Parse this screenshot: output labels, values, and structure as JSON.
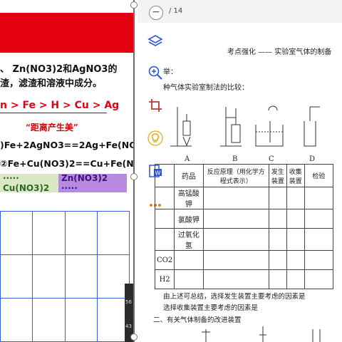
{
  "left_panel": {
    "line1": "、 Zn(NO3)2和AgNO3的",
    "line2": "渣，滤渣和溶液中成分。",
    "order": "n > Fe > H > Cu > Ag",
    "slogan": "“距离产生美”",
    "eq1": ")Fe+2AgNO3==2Ag+Fe(NO3)2",
    "eq2": "②Fe+Cu(NO3)2==Cu+Fe(NO3)2",
    "strip1": "····· Cu(NO3)2",
    "strip2": "Zn(NO3)2 ·····"
  },
  "viewer": {
    "page_count": "/ 14",
    "zoom_out_label": "−"
  },
  "tools": [
    {
      "icon": "layers-icon",
      "color": "#2f55d4"
    },
    {
      "icon": "zoom-in-icon",
      "color": "#2f55d4"
    },
    {
      "icon": "crop-icon",
      "color": "#c0392b"
    },
    {
      "icon": "lightbulb-icon",
      "color": "#e6a817"
    },
    {
      "icon": "word-export-icon",
      "color": "#2f55d4"
    },
    {
      "icon": "more-icon",
      "color": "#e67e22"
    }
  ],
  "document": {
    "header": "考点强化 —— 实验室气体的制备",
    "section_frag": "举：",
    "intro": "种气体实验室制法的比较：",
    "apparatus_labels": [
      "A",
      "B",
      "C",
      "D"
    ],
    "table_head": [
      "药品",
      "反应原理（用化学方程式表示）",
      "发生装置",
      "收集装置",
      "检验"
    ],
    "rows": [
      "高锰酸钾",
      "氯酸钾",
      "过氧化氢"
    ],
    "gas_rows": [
      "CO2",
      "H2"
    ],
    "summary1": "由上述可总结，选择发生装置主要考虑的因素是",
    "summary2": "选择收集装置主要考虑的因素是",
    "section2": "二、有关气体制备的改进装置"
  },
  "status_bar": {
    "t1": "56",
    "t2": "43"
  }
}
